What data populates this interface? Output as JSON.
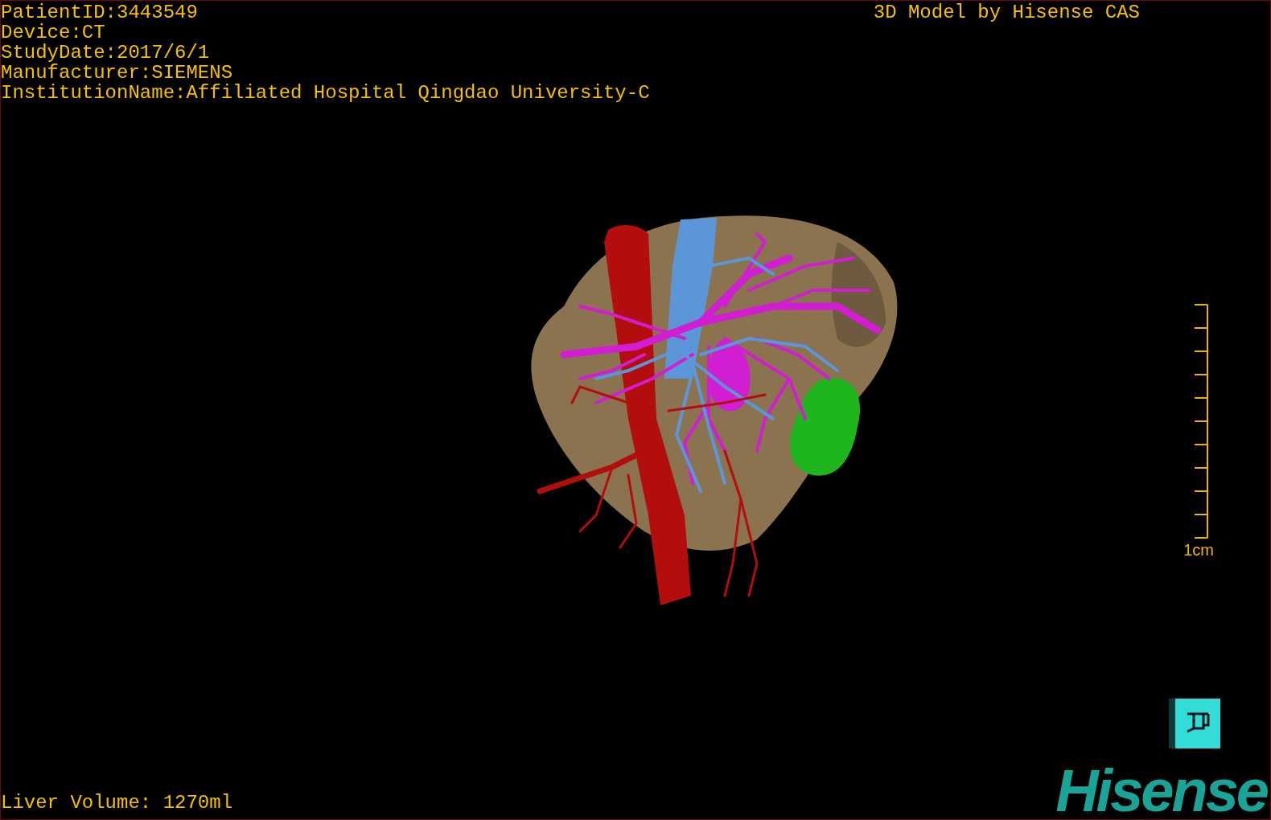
{
  "info_lines": [
    "PatientID:3443549",
    "Device:CT",
    "StudyDate:2017/6/1",
    "Manufacturer:SIEMENS",
    "InstitutionName:Affiliated Hospital Qingdao University-C"
  ],
  "title": "3D Model by Hisense CAS",
  "scale_bar": {
    "label": "1cm"
  },
  "liver_volume": "Liver Volume: 1270ml",
  "logo": {
    "text": "Hisense"
  }
}
